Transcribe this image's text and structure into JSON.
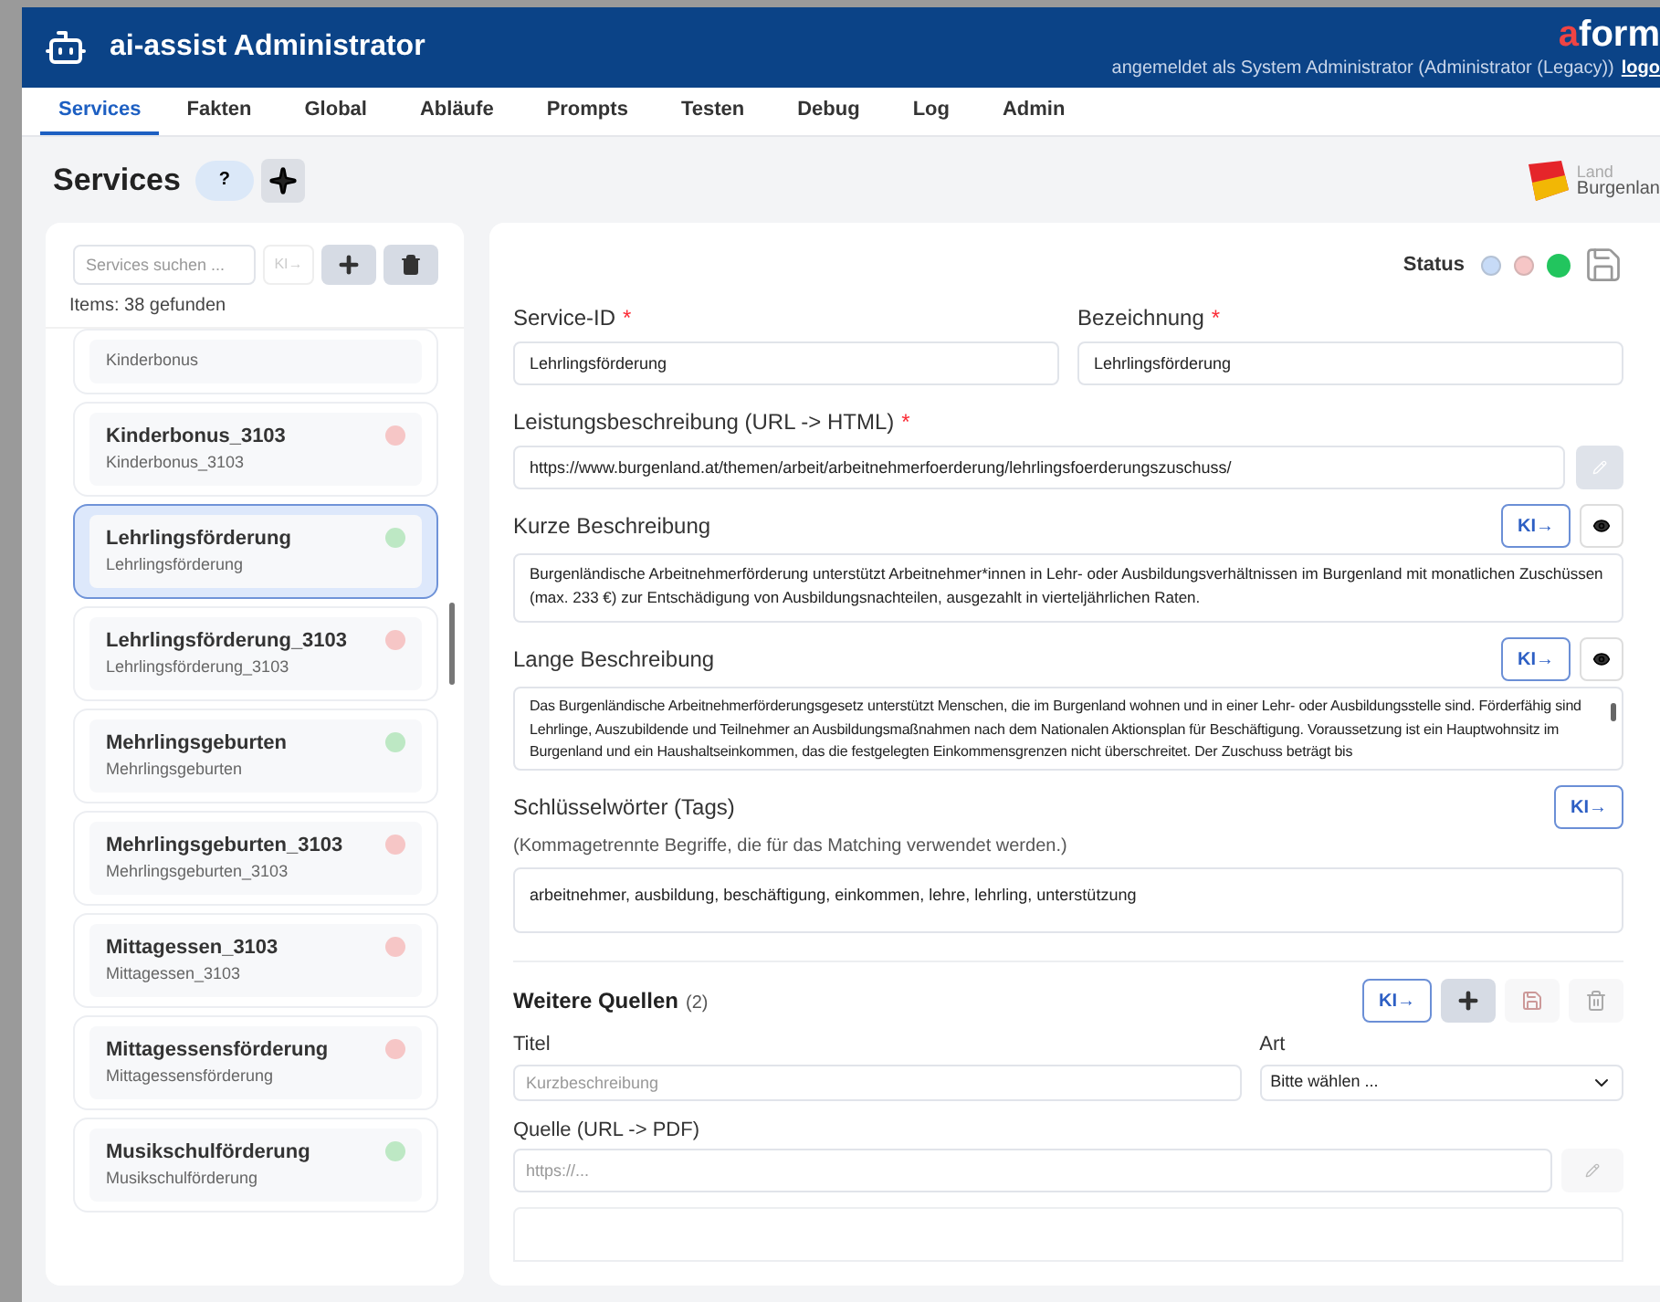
{
  "header": {
    "app_title": "ai-assist Administrator",
    "brand": {
      "accent": "a",
      "rest": "form"
    },
    "user_info": "angemeldet als System Administrator (Administrator (Legacy))",
    "logout": "logo"
  },
  "tabs": [
    {
      "label": "Services",
      "selected": true
    },
    {
      "label": "Fakten",
      "selected": false
    },
    {
      "label": "Global",
      "selected": false
    },
    {
      "label": "Abläufe",
      "selected": false
    },
    {
      "label": "Prompts",
      "selected": false
    },
    {
      "label": "Testen",
      "selected": false
    },
    {
      "label": "Debug",
      "selected": false
    },
    {
      "label": "Log",
      "selected": false
    },
    {
      "label": "Admin",
      "selected": false
    }
  ],
  "page": {
    "title": "Services",
    "help": "?",
    "crest": {
      "line1": "Land",
      "line2": "Burgenlan"
    }
  },
  "sidebar": {
    "search_placeholder": "Services suchen ...",
    "ai_button": "KI→",
    "count": "Items: 38 gefunden",
    "items": [
      {
        "subtitle": "Kinderbonus",
        "selected": false
      },
      {
        "title": "Kinderbonus_3103",
        "subtitle": "Kinderbonus_3103",
        "color": "#f6c6c6",
        "selected": false
      },
      {
        "title": "Lehrlingsförderung",
        "subtitle": "Lehrlingsförderung",
        "color": "#bde8c4",
        "selected": true
      },
      {
        "title": "Lehrlingsförderung_3103",
        "subtitle": "Lehrlingsförderung_3103",
        "color": "#f6c6c6",
        "selected": false
      },
      {
        "title": "Mehrlingsgeburten",
        "subtitle": "Mehrlingsgeburten",
        "color": "#bde8c4",
        "selected": false
      },
      {
        "title": "Mehrlingsgeburten_3103",
        "subtitle": "Mehrlingsgeburten_3103",
        "color": "#f6c6c6",
        "selected": false
      },
      {
        "title": "Mittagessen_3103",
        "subtitle": "Mittagessen_3103",
        "color": "#f6c6c6",
        "selected": false
      },
      {
        "title": "Mittagessensförderung",
        "subtitle": "Mittagessensförderung",
        "color": "#f6c6c6",
        "selected": false
      },
      {
        "title": "Musikschulförderung",
        "subtitle": "Musikschulförderung",
        "color": "#bde8c4",
        "selected": false
      }
    ]
  },
  "form": {
    "status_label": "Status",
    "status_options": [
      {
        "color": "#c7dbf7",
        "selected": false
      },
      {
        "color": "#f6c6c6",
        "selected": false
      },
      {
        "color": "#22c55e",
        "selected": true
      }
    ],
    "service_id": {
      "label": "Service-ID",
      "required_mark": "*",
      "value": "Lehrlingsförderung"
    },
    "name": {
      "label": "Bezeichnung",
      "required_mark": "*",
      "value": "Lehrlingsförderung"
    },
    "url": {
      "label": "Leistungsbeschreibung (URL -> HTML)",
      "required_mark": "*",
      "value": "https://www.burgenland.at/themen/arbeit/arbeitnehmerfoerderung/lehrlingsfoerderungszuschuss/"
    },
    "short_description": {
      "label": "Kurze Beschreibung",
      "ai_button": "KI→",
      "value": "Burgenländische Arbeitnehmerförderung unterstützt Arbeitnehmer*innen in Lehr- oder Ausbildungsverhältnissen im Burgenland mit monatlichen Zuschüssen (max. 233 €) zur Entschädigung von Ausbildungsnachteilen, ausgezahlt in vierteljährlichen Raten."
    },
    "long_description": {
      "label": "Lange Beschreibung",
      "ai_button": "KI→",
      "value": "Das Burgenländische Arbeitnehmerförderungsgesetz unterstützt Menschen, die im Burgenland wohnen und in einer Lehr- oder Ausbildungsstelle sind. Förderfähig sind Lehrlinge, Auszubildende und Teilnehmer an Ausbildungsmaßnahmen nach dem Nationalen Aktionsplan für Beschäftigung. Voraussetzung ist ein Hauptwohnsitz im Burgenland und ein Haushaltseinkommen, das die festgelegten Einkommensgrenzen nicht überschreitet. Der Zuschuss beträgt bis"
    },
    "tags": {
      "label": "Schlüsselwörter (Tags)",
      "ai_button": "KI→",
      "hint": "(Kommagetrennte Begriffe, die für das Matching verwendet werden.)",
      "value": "arbeitnehmer, ausbildung, beschäftigung, einkommen, lehre, lehrling, unterstützung"
    },
    "sources": {
      "title": "Weitere Quellen",
      "count": "(2)",
      "ai_button": "KI→",
      "title_label": "Titel",
      "title_placeholder": "Kurzbeschreibung",
      "type_label": "Art",
      "type_value": "Bitte wählen ...",
      "url_label": "Quelle (URL -> PDF)",
      "url_placeholder": "https://..."
    }
  }
}
